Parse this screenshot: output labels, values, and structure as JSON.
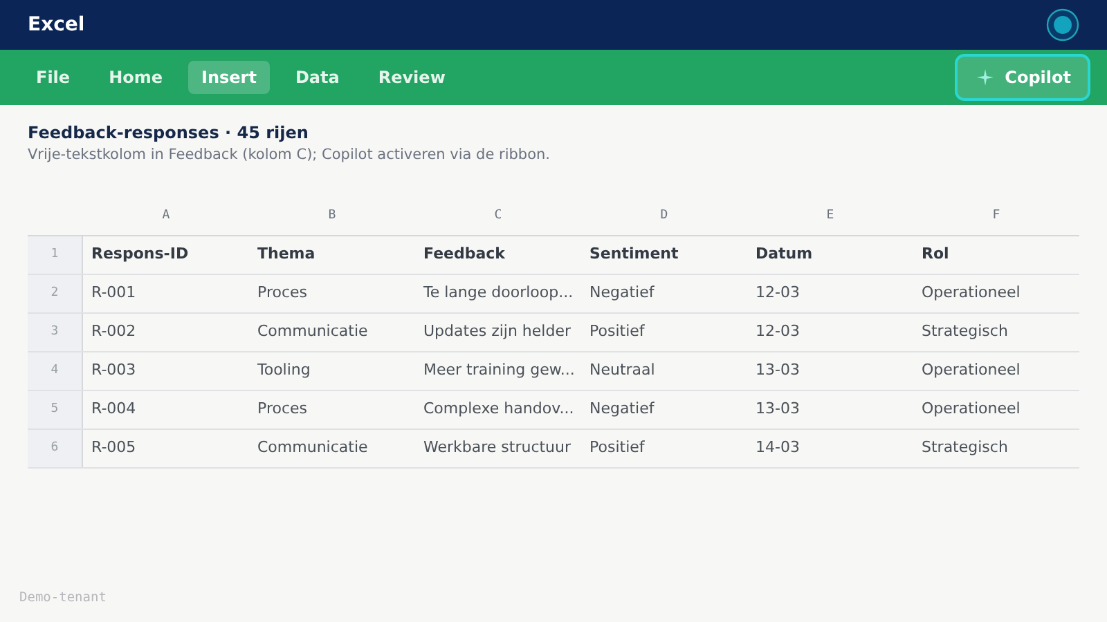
{
  "app_title": "Excel",
  "ribbon_tabs": [
    {
      "label": "File",
      "selected": false
    },
    {
      "label": "Home",
      "selected": false
    },
    {
      "label": "Insert",
      "selected": true
    },
    {
      "label": "Data",
      "selected": false
    },
    {
      "label": "Review",
      "selected": false
    }
  ],
  "copilot_button": {
    "label": "Copilot"
  },
  "sheet": {
    "title": "Feedback-responses · 45 rijen",
    "subtitle": "Vrije-tekstkolom in Feedback (kolom C); Copilot activeren via de ribbon."
  },
  "grid": {
    "column_letters": [
      "A",
      "B",
      "C",
      "D",
      "E",
      "F"
    ],
    "rows": [
      {
        "number": "1",
        "kind": "header",
        "cells": [
          "Respons-ID",
          "Thema",
          "Feedback",
          "Sentiment",
          "Datum",
          "Rol"
        ]
      },
      {
        "number": "2",
        "kind": "data",
        "cells": [
          "R-001",
          "Proces",
          "Te lange doorloop...",
          "Negatief",
          "12-03",
          "Operationeel"
        ]
      },
      {
        "number": "3",
        "kind": "data",
        "cells": [
          "R-002",
          "Communicatie",
          "Updates zijn helder",
          "Positief",
          "12-03",
          "Strategisch"
        ]
      },
      {
        "number": "4",
        "kind": "data",
        "cells": [
          "R-003",
          "Tooling",
          "Meer training gew...",
          "Neutraal",
          "13-03",
          "Operationeel"
        ]
      },
      {
        "number": "5",
        "kind": "data",
        "cells": [
          "R-004",
          "Proces",
          "Complexe handov...",
          "Negatief",
          "13-03",
          "Operationeel"
        ]
      },
      {
        "number": "6",
        "kind": "data",
        "cells": [
          "R-005",
          "Communicatie",
          "Werkbare structuur",
          "Positief",
          "14-03",
          "Strategisch"
        ]
      }
    ]
  },
  "footer": "Demo-tenant"
}
